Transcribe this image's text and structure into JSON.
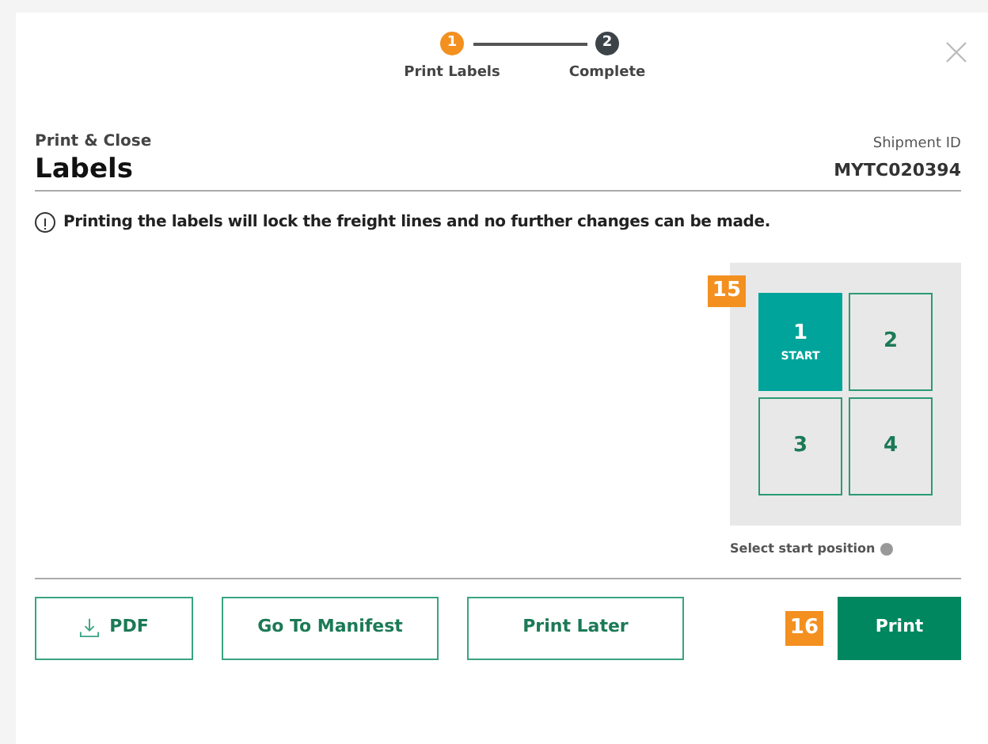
{
  "steps": [
    {
      "number": "1",
      "label": "Print Labels",
      "selected": true
    },
    {
      "number": "2",
      "label": "Complete",
      "selected": false
    }
  ],
  "header": {
    "subtitle": "Print & Close",
    "title": "Labels",
    "shipment_label": "Shipment ID",
    "shipment_id": "MYTC020394"
  },
  "warning": "Printing the labels will lock the freight lines and no further changes can be made.",
  "position_badge": "15",
  "positions": [
    {
      "number": "1",
      "sublabel": "START",
      "selected": true
    },
    {
      "number": "2",
      "selected": false
    },
    {
      "number": "3",
      "selected": false
    },
    {
      "number": "4",
      "selected": false
    }
  ],
  "position_caption": "Select start position",
  "buttons": [
    {
      "label": "PDF",
      "kind": "download"
    },
    {
      "label": "Go To Manifest",
      "kind": "outline"
    },
    {
      "label": "Print Later",
      "kind": "outline"
    }
  ],
  "print_badge": "16",
  "print_button": "Print"
}
